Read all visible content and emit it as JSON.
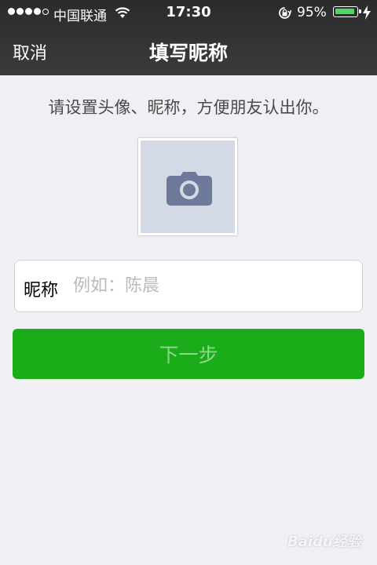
{
  "status_bar": {
    "carrier": "中国联通",
    "time": "17:30",
    "battery_percent": "95%",
    "battery_level": 0.95
  },
  "nav": {
    "cancel_label": "取消",
    "title": "填写昵称"
  },
  "prompt": "请设置头像、昵称，方便朋友认出你。",
  "avatar": {
    "icon": "camera-icon"
  },
  "nickname": {
    "label": "昵称",
    "placeholder": "例如：陈晨",
    "value": ""
  },
  "next_button_label": "下一步",
  "watermark": "Baidu经验",
  "colors": {
    "nav_background": "#333335",
    "page_background": "#efeff4",
    "button_green": "#1aad19",
    "button_text_disabled": "#8fd68f",
    "avatar_placeholder": "#d3d9e5",
    "camera_icon": "#6d7a99",
    "battery_green": "#4cd964"
  }
}
